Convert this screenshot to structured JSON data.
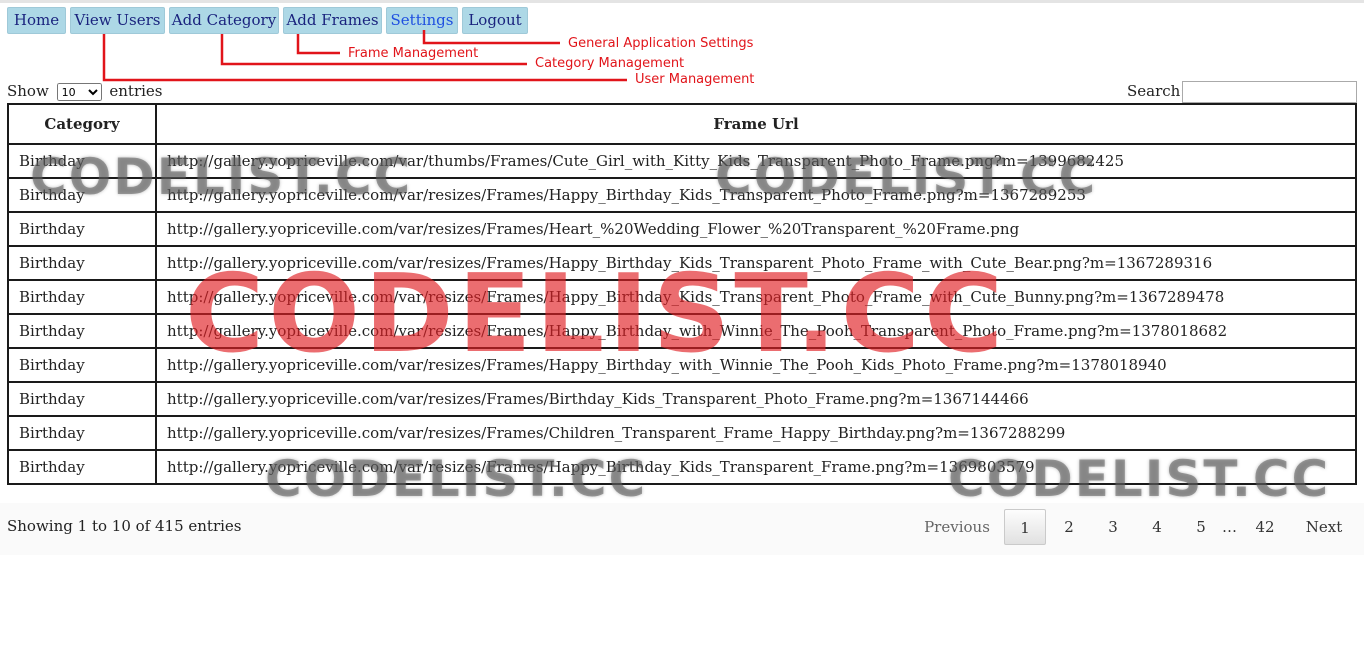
{
  "nav": {
    "items": [
      {
        "label": "Home"
      },
      {
        "label": "View Users"
      },
      {
        "label": "Add Category"
      },
      {
        "label": "Add Frames"
      },
      {
        "label": "Settings"
      },
      {
        "label": "Logout"
      }
    ]
  },
  "annotations": {
    "settings": "General Application Settings",
    "frames": "Frame Management",
    "category": "Category Management",
    "users": "User Management",
    "color": "#e1141a"
  },
  "controls": {
    "show_label": "Show",
    "show_value": "10",
    "entries_label": "entries",
    "search_label": "Search:",
    "search_value": ""
  },
  "table": {
    "headers": [
      "Category",
      "Frame Url"
    ],
    "rows": [
      [
        "Birthday",
        "http://gallery.yopriceville.com/var/thumbs/Frames/Cute_Girl_with_Kitty_Kids_Transparent_Photo_Frame.png?m=1399682425"
      ],
      [
        "Birthday",
        "http://gallery.yopriceville.com/var/resizes/Frames/Happy_Birthday_Kids_Transparent_Photo_Frame.png?m=1367289253"
      ],
      [
        "Birthday",
        "http://gallery.yopriceville.com/var/resizes/Frames/Heart_%20Wedding_Flower_%20Transparent_%20Frame.png"
      ],
      [
        "Birthday",
        "http://gallery.yopriceville.com/var/resizes/Frames/Happy_Birthday_Kids_Transparent_Photo_Frame_with_Cute_Bear.png?m=1367289316"
      ],
      [
        "Birthday",
        "http://gallery.yopriceville.com/var/resizes/Frames/Happy_Birthday_Kids_Transparent_Photo_Frame_with_Cute_Bunny.png?m=1367289478"
      ],
      [
        "Birthday",
        "http://gallery.yopriceville.com/var/resizes/Frames/Happy_Birthday_with_Winnie_The_Pooh_Transparent_Photo_Frame.png?m=1378018682"
      ],
      [
        "Birthday",
        "http://gallery.yopriceville.com/var/resizes/Frames/Happy_Birthday_with_Winnie_The_Pooh_Kids_Photo_Frame.png?m=1378018940"
      ],
      [
        "Birthday",
        "http://gallery.yopriceville.com/var/resizes/Frames/Birthday_Kids_Transparent_Photo_Frame.png?m=1367144466"
      ],
      [
        "Birthday",
        "http://gallery.yopriceville.com/var/resizes/Frames/Children_Transparent_Frame_Happy_Birthday.png?m=1367288299"
      ],
      [
        "Birthday",
        "http://gallery.yopriceville.com/var/resizes/Frames/Happy_Birthday_Kids_Transparent_Frame.png?m=1369803579"
      ]
    ]
  },
  "info": "Showing 1 to 10 of 415 entries",
  "pagination": {
    "previous": "Previous",
    "pages": [
      "1",
      "2",
      "3",
      "4",
      "5"
    ],
    "ellipsis": "…",
    "last": "42",
    "next": "Next",
    "current": "1"
  },
  "watermark": {
    "text": "CODELIST.CC",
    "gray_color": "#5a5a5a",
    "red_color": "#e11e23"
  }
}
